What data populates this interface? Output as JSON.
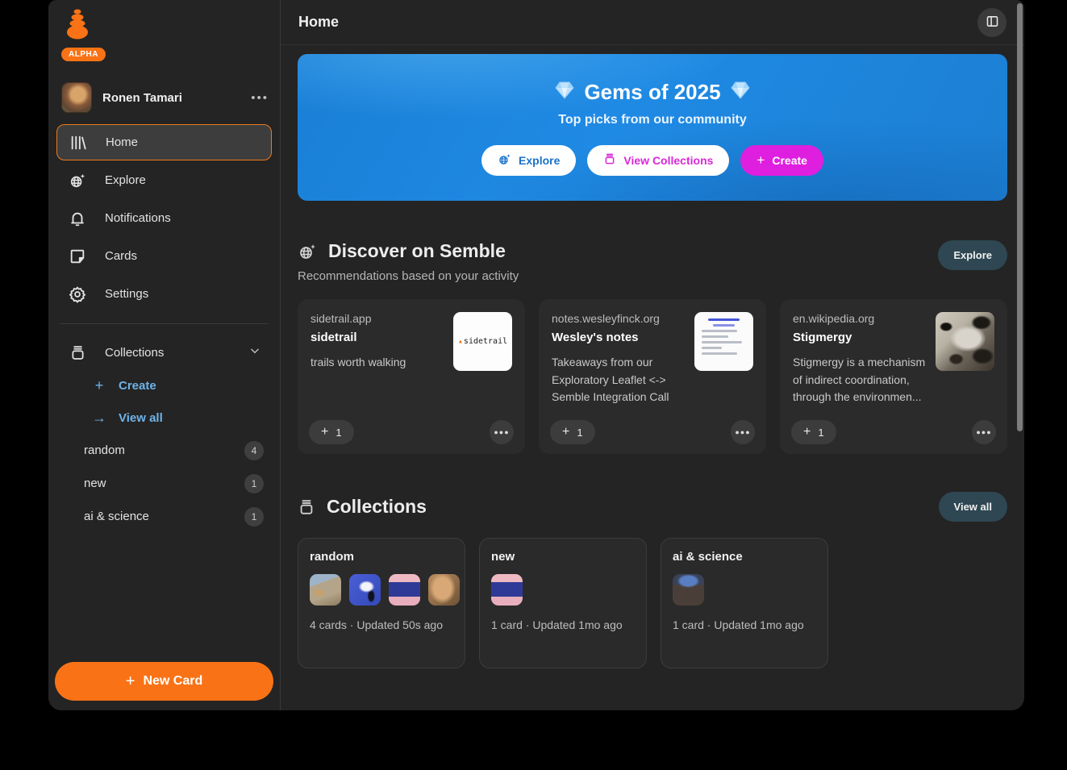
{
  "sidebar": {
    "alpha_badge": "ALPHA",
    "profile": {
      "name": "Ronen Tamari",
      "menu_glyph": "•••"
    },
    "nav": [
      {
        "label": "Home"
      },
      {
        "label": "Explore"
      },
      {
        "label": "Notifications"
      },
      {
        "label": "Cards"
      },
      {
        "label": "Settings"
      }
    ],
    "collections": {
      "label": "Collections",
      "create_label": "Create",
      "view_all_label": "View all",
      "items": [
        {
          "label": "random",
          "count": "4"
        },
        {
          "label": "new",
          "count": "1"
        },
        {
          "label": "ai & science",
          "count": "1"
        }
      ]
    },
    "new_card_label": "New Card"
  },
  "topbar": {
    "title": "Home"
  },
  "hero": {
    "title": "Gems of 2025",
    "subtitle": "Top picks from our community",
    "explore_label": "Explore",
    "view_collections_label": "View Collections",
    "create_label": "Create"
  },
  "discover": {
    "title": "Discover on Semble",
    "subtitle": "Recommendations based on your activity",
    "action_label": "Explore",
    "cards": [
      {
        "domain": "sidetrail.app",
        "title": "sidetrail",
        "description": "trails worth walking",
        "add_count": "1",
        "thumb_text": "sidetrail"
      },
      {
        "domain": "notes.wesleyfinck.org",
        "title": "Wesley's notes",
        "description": "Takeaways from our Exploratory Leaflet <-> Semble Integration Call",
        "add_count": "1"
      },
      {
        "domain": "en.wikipedia.org",
        "title": "Stigmergy",
        "description": "Stigmergy is a mechanism of indirect coordination, through the environmen...",
        "add_count": "1"
      }
    ]
  },
  "collections_section": {
    "title": "Collections",
    "action_label": "View all",
    "cards": [
      {
        "title": "random",
        "meta": "4 cards · Updated 50s ago"
      },
      {
        "title": "new",
        "meta": "1 card · Updated 1mo ago"
      },
      {
        "title": "ai & science",
        "meta": "1 card · Updated 1mo ago"
      }
    ]
  },
  "colors": {
    "accent_orange": "#f97316",
    "hero_blue": "#1f8ae4",
    "magenta": "#df1fdf",
    "link_blue": "#6fb3e8"
  }
}
